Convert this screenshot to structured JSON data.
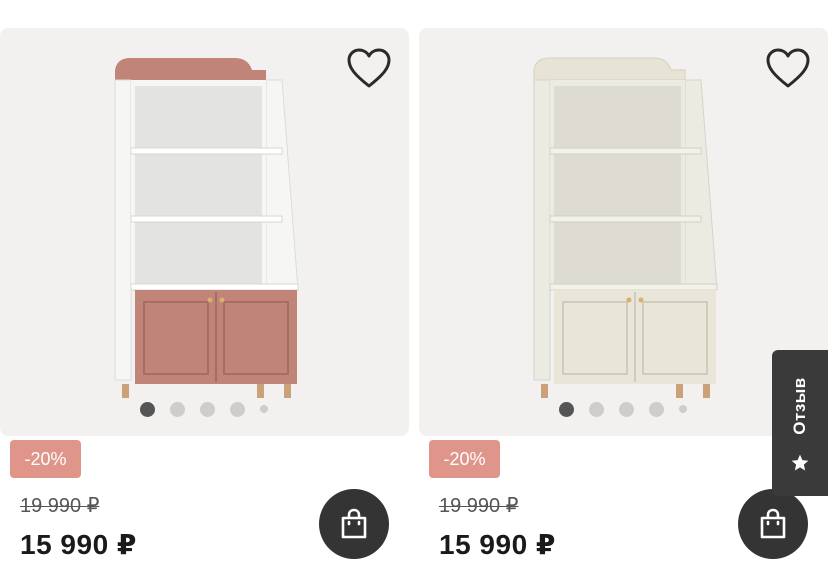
{
  "products": [
    {
      "variant": "pink",
      "colors": {
        "body": "#f6f6f5",
        "accent": "#c08478",
        "accent_dark": "#a86d62",
        "shade": "#e3e3e1"
      },
      "icons": {
        "favorite": "heart-outline-icon",
        "cart": "shopping-bag-icon"
      },
      "carousel": {
        "total_dots": 5,
        "active_index": 0
      },
      "discount_badge": "-20%",
      "old_price": "19 990 ₽",
      "price": "15 990 ₽"
    },
    {
      "variant": "beige",
      "colors": {
        "body": "#ecebe2",
        "accent": "#e7e4d6",
        "accent_dark": "#cfcbbd",
        "shade": "#dedcd2"
      },
      "icons": {
        "favorite": "heart-outline-icon",
        "cart": "shopping-bag-icon"
      },
      "carousel": {
        "total_dots": 5,
        "active_index": 0
      },
      "discount_badge": "-20%",
      "old_price": "19 990 ₽",
      "price": "15 990 ₽"
    }
  ],
  "review_tab": {
    "label": "Отзыв",
    "icon": "star-icon"
  }
}
